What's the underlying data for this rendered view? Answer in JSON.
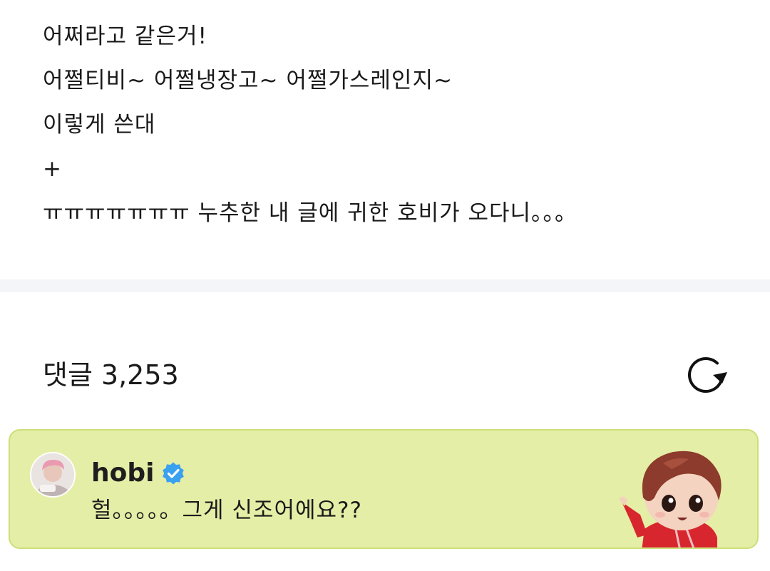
{
  "post": {
    "lines": [
      "어쩌라고 같은거!",
      "어쩔티비~ 어쩔냉장고~ 어쩔가스레인지~",
      "이렇게 쓴대",
      "+",
      "ㅠㅠㅠㅠㅠㅠㅠ 누추한 내 글에 귀한 호비가 오다니。。。"
    ]
  },
  "comments": {
    "title": "댓글",
    "count": "3,253",
    "refresh_icon": "refresh-icon"
  },
  "featured_comment": {
    "author": "hobi",
    "verified_icon": "verified-badge-icon",
    "verified_color": "#3aa0f0",
    "text": "헐。。。。。그게 신조어에요??",
    "background_color": "#e5eea6",
    "border_color": "#cddf7a",
    "sticker_icon": "character-sticker-icon"
  }
}
